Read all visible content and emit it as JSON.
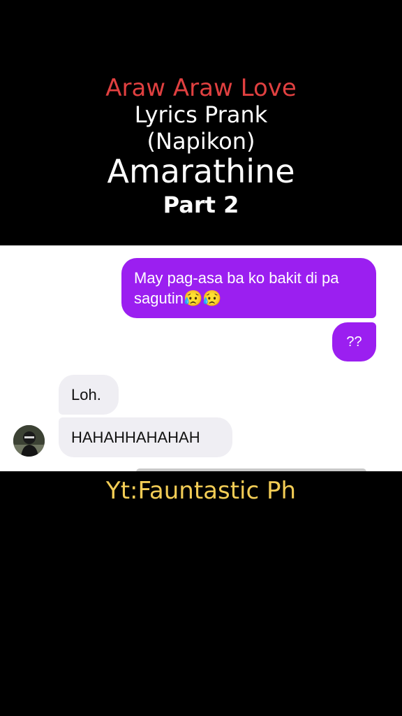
{
  "title": {
    "line1": "Araw Araw Love",
    "line2": "Lyrics Prank",
    "line3": "(Napikon)",
    "line4": "Amarathine",
    "line5": "Part 2"
  },
  "messages": [
    {
      "sender": "me",
      "text": "May pag-asa ba ko bakit di pa sagutin😥😥"
    },
    {
      "sender": "me",
      "text": "??"
    },
    {
      "sender": "them",
      "text": "Loh."
    },
    {
      "sender": "them",
      "text": "HAHAHHAHAHAH"
    }
  ],
  "credit": "Yt:Fauntastic Ph",
  "colors": {
    "sent_bubble": "#9b1ff0",
    "received_bubble": "#efeef3",
    "title_accent": "#e04040",
    "credit_text": "#f2cc55"
  },
  "icons": {
    "contact_avatar": "avatar-icon"
  }
}
